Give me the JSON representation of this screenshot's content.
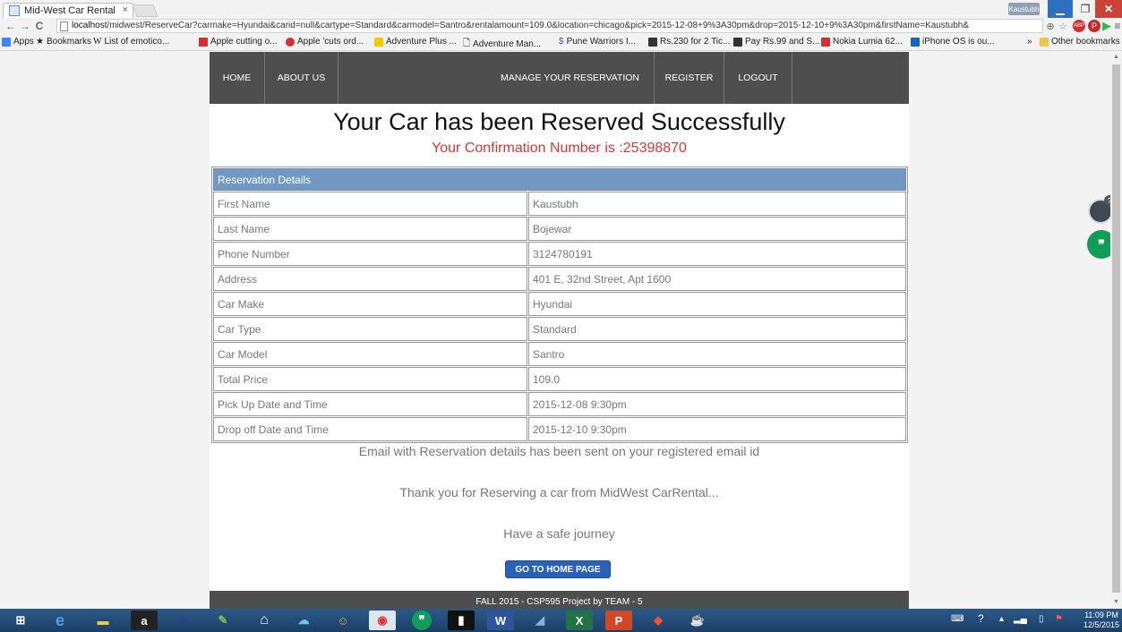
{
  "browser": {
    "tab_title": "Mid-West Car Rental",
    "tab_close": "×",
    "user_chip": "Kaustubh",
    "url_host": "localhost",
    "url_rest": "/midwest/ReserveCar?carmake=Hyundai&carid=null&cartype=Standard&carmodel=Santro&rentalamount=109.0&location=chicago&pick=2015-12-08+9%3A30pm&drop=2015-12-10+9%3A30pm&firstName=Kaustubh&",
    "bookmarks": [
      {
        "label": "Apps",
        "color": "#4285f4"
      },
      {
        "label": "Bookmarks",
        "color": "#f4b400"
      },
      {
        "label": "List of emotico...",
        "color": "#888888"
      },
      {
        "label": "Apple cutting o...",
        "color": "#d32f2f"
      },
      {
        "label": "Apple 'cuts ord...",
        "color": "#d32f2f"
      },
      {
        "label": "Adventure Plus ...",
        "color": "#f6c800"
      },
      {
        "label": "Adventure Man...",
        "color": "#999999"
      },
      {
        "label": "Pune Warriors I...",
        "color": "#3b5fc0"
      },
      {
        "label": "Rs.230 for 2 Tic...",
        "color": "#333333"
      },
      {
        "label": "Pay Rs.99 and S...",
        "color": "#333333"
      },
      {
        "label": "Nokia Lumia 62...",
        "color": "#d32f2f"
      },
      {
        "label": "iPhone OS is ou...",
        "color": "#1565c0"
      }
    ],
    "more_bookmarks": "»",
    "other_bookmarks": "Other bookmarks"
  },
  "nav": {
    "home": "HOME",
    "about": "ABOUT US",
    "manage": "MANAGE YOUR RESERVATION",
    "register": "REGISTER",
    "logout": "LOGOUT"
  },
  "main": {
    "headline": "Your Car has been Reserved Successfully",
    "confirmation": "Your Confirmation Number is :25398870",
    "table_header": "Reservation Details",
    "rows": [
      {
        "label": "First Name",
        "value": "Kaustubh"
      },
      {
        "label": "Last Name",
        "value": "Bojewar"
      },
      {
        "label": "Phone Number",
        "value": "3124780191"
      },
      {
        "label": "Address",
        "value": "401 E, 32nd Street, Apt 1600"
      },
      {
        "label": "Car Make",
        "value": "Hyundai"
      },
      {
        "label": "Car Type",
        "value": "Standard"
      },
      {
        "label": "Car Model",
        "value": "Santro"
      },
      {
        "label": "Total Price",
        "value": "109.0"
      },
      {
        "label": "Pick Up Date and Time",
        "value": "2015-12-08 9:30pm"
      },
      {
        "label": "Drop off Date and Time",
        "value": "2015-12-10 9:30pm"
      }
    ],
    "email_msg": "Email with Reservation details has been sent on your registered email id",
    "thanks_msg": "Thank you for Reserving a car from MidWest CarRental...",
    "safe_msg": "Have a safe journey",
    "home_button": "GO TO HOME PAGE",
    "footer": "FALL 2015 - CSP595 Project by TEAM - 5"
  },
  "taskbar": {
    "time": "11:09 PM",
    "date": "12/5/2015"
  },
  "colors": {
    "nav_bg": "#4e4e4e",
    "table_header_bg": "#7198c3",
    "confirmation_red": "#d73636",
    "button_blue": "#2a62b8"
  }
}
